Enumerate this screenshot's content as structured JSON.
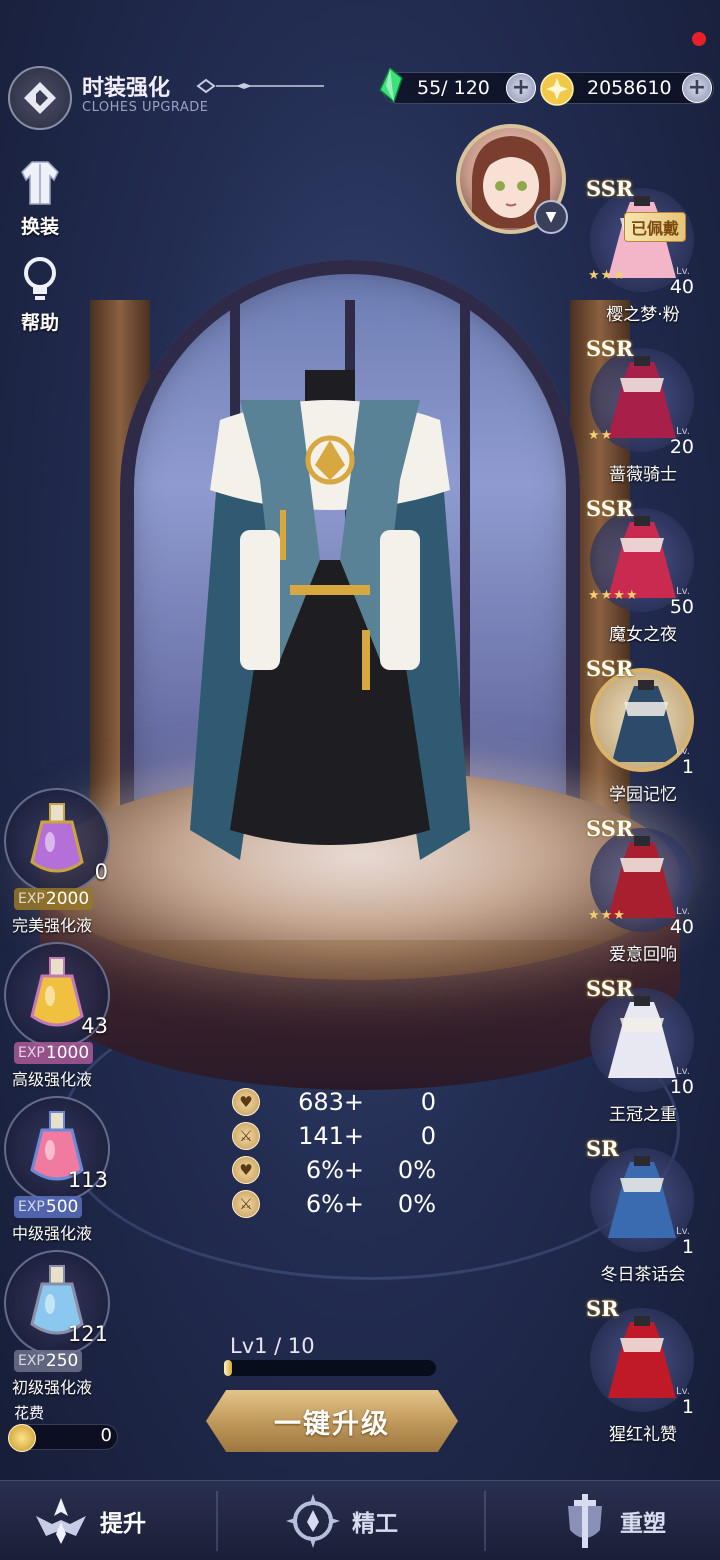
{
  "header": {
    "title": "时装强化",
    "subtitle": "CLOHES UPGRADE",
    "energy": "55/ 120",
    "gold": "2058610"
  },
  "side_buttons": [
    {
      "label": "换装",
      "icon": "outfit-icon"
    },
    {
      "label": "帮助",
      "icon": "lightbulb-icon"
    }
  ],
  "outfits": [
    {
      "rarity": "SSR",
      "stars": "★★★",
      "lv_tag": "Lv.",
      "level": "40",
      "name": "樱之梦·粉",
      "equipped": "已佩戴",
      "color": "#f2b6c8"
    },
    {
      "rarity": "SSR",
      "stars": "★★",
      "lv_tag": "Lv.",
      "level": "20",
      "name": "蔷薇骑士",
      "color": "#a8204a"
    },
    {
      "rarity": "SSR",
      "stars": "★★★★",
      "lv_tag": "Lv.",
      "level": "50",
      "name": "魔女之夜",
      "color": "#c82a50"
    },
    {
      "rarity": "SSR",
      "stars": "",
      "lv_tag": "Lv.",
      "level": "1",
      "name": "学园记忆",
      "color": "#2e4a6a"
    },
    {
      "rarity": "SSR",
      "stars": "★★★",
      "lv_tag": "Lv.",
      "level": "40",
      "name": "爱意回响",
      "color": "#a82030"
    },
    {
      "rarity": "SSR",
      "stars": "",
      "lv_tag": "Lv.",
      "level": "10",
      "name": "王冠之重",
      "color": "#e8e8f2"
    },
    {
      "rarity": "SR",
      "stars": "",
      "lv_tag": "Lv.",
      "level": "1",
      "name": "冬日茶话会",
      "color": "#3a6ab0"
    },
    {
      "rarity": "SR",
      "stars": "",
      "lv_tag": "Lv.",
      "level": "1",
      "name": "猩红礼赞",
      "color": "#c01a28"
    }
  ],
  "materials": [
    {
      "count": "0",
      "exp_label": "EXP",
      "exp": "2000",
      "name": "完美强化液",
      "color": "#c9a440",
      "liquid": "#b470d8"
    },
    {
      "count": "43",
      "exp_label": "EXP",
      "exp": "1000",
      "name": "高级强化液",
      "color": "#c07ab8",
      "liquid": "#f0c040"
    },
    {
      "count": "113",
      "exp_label": "EXP",
      "exp": "500",
      "name": "中级强化液",
      "color": "#6a8ad8",
      "liquid": "#f07aa0"
    },
    {
      "count": "121",
      "exp_label": "EXP",
      "exp": "250",
      "name": "初级强化液",
      "color": "#8a8ea8",
      "liquid": "#8ac8f0"
    }
  ],
  "cost": {
    "label": "花费",
    "value": "0"
  },
  "stats": [
    {
      "icon": "heart-icon",
      "value": "683+",
      "add": "0"
    },
    {
      "icon": "sword-icon",
      "value": "141+",
      "add": "0"
    },
    {
      "icon": "heart-plus-icon",
      "value": "6%+",
      "add": "0%"
    },
    {
      "icon": "sword-plus-icon",
      "value": "6%+",
      "add": "0%"
    }
  ],
  "level": {
    "label": "Lv1  / 10",
    "progress": 0.02
  },
  "upgrade_button": "一键升级",
  "nav": [
    {
      "label": "提升",
      "icon": "upgrade-emblem-icon"
    },
    {
      "label": "精工",
      "icon": "craft-emblem-icon"
    },
    {
      "label": "重塑",
      "icon": "reshape-emblem-icon"
    }
  ]
}
